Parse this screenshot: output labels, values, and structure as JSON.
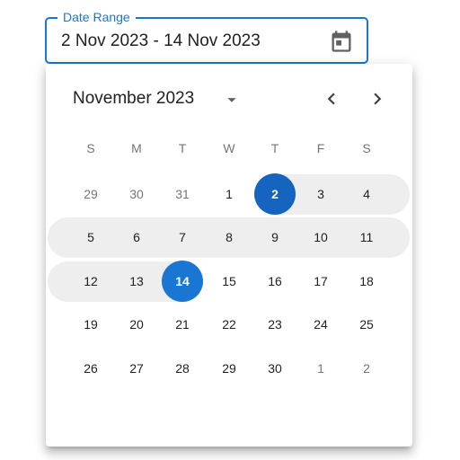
{
  "field": {
    "label": "Date Range",
    "value": "2 Nov 2023 - 14 Nov 2023",
    "icon": "calendar-icon",
    "accent_color": "#1976d2"
  },
  "calendar": {
    "month_label": "November 2023",
    "dropdown_icon": "caret-down-icon",
    "prev_icon": "chevron-left-icon",
    "next_icon": "chevron-right-icon",
    "weekdays": [
      "S",
      "M",
      "T",
      "W",
      "T",
      "F",
      "S"
    ],
    "weeks": [
      [
        {
          "label": "29",
          "out": true
        },
        {
          "label": "30",
          "out": true
        },
        {
          "label": "31",
          "out": true
        },
        {
          "label": "1"
        },
        {
          "label": "2",
          "state": "start"
        },
        {
          "label": "3",
          "state": "in"
        },
        {
          "label": "4",
          "state": "in"
        }
      ],
      [
        {
          "label": "5",
          "state": "in"
        },
        {
          "label": "6",
          "state": "in"
        },
        {
          "label": "7",
          "state": "in"
        },
        {
          "label": "8",
          "state": "in"
        },
        {
          "label": "9",
          "state": "in"
        },
        {
          "label": "10",
          "state": "in"
        },
        {
          "label": "11",
          "state": "in"
        }
      ],
      [
        {
          "label": "12",
          "state": "in"
        },
        {
          "label": "13",
          "state": "in"
        },
        {
          "label": "14",
          "state": "end"
        },
        {
          "label": "15"
        },
        {
          "label": "16"
        },
        {
          "label": "17"
        },
        {
          "label": "18"
        }
      ],
      [
        {
          "label": "19"
        },
        {
          "label": "20"
        },
        {
          "label": "21"
        },
        {
          "label": "22"
        },
        {
          "label": "23"
        },
        {
          "label": "24"
        },
        {
          "label": "25"
        }
      ],
      [
        {
          "label": "26"
        },
        {
          "label": "27"
        },
        {
          "label": "28"
        },
        {
          "label": "29"
        },
        {
          "label": "30"
        },
        {
          "label": "1",
          "out": true
        },
        {
          "label": "2",
          "out": true
        }
      ]
    ],
    "selected_color": "#1565c0",
    "range_color": "#eeeeee"
  }
}
